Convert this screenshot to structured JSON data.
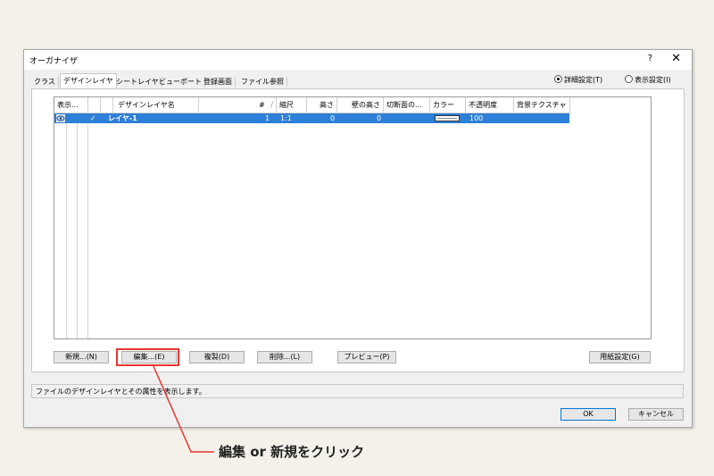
{
  "window": {
    "title": "オーガナイザ",
    "help": "?",
    "close": "✕"
  },
  "tabs": [
    "クラス",
    "デザインレイヤ",
    "シートレイヤ",
    "ビューポート",
    "登録画面",
    "ファイル参照"
  ],
  "active_tab": "デザインレイヤ",
  "view_mode": {
    "detail": "詳細設定(T)",
    "display": "表示設定(I)",
    "selected": "detail"
  },
  "table": {
    "headers": [
      "表示...",
      "",
      "",
      "デザインレイヤ名",
      "#",
      "縮尺",
      "高さ",
      "壁の高さ",
      "切断面の...",
      "カラー",
      "不透明度",
      "背景テクスチャ"
    ],
    "sort_marker": "/",
    "rows": [
      {
        "visible_icon": "eye-icon",
        "active": "✓",
        "name": "レイヤ-1",
        "number": "1",
        "scale": "1:1",
        "elevation": "0",
        "wall_height": "0",
        "color_swatch": "pattern",
        "opacity": "100",
        "texture": ""
      }
    ]
  },
  "buttons": {
    "new": "新規...(N)",
    "edit": "編集...(E)",
    "duplicate": "複製(D)",
    "delete": "削除...(L)",
    "preview": "プレビュー(P)",
    "page_setup": "用紙設定(G)",
    "ok": "OK",
    "cancel": "キャンセル"
  },
  "status": "ファイルのデザインレイヤとその属性を表示します。",
  "annotation": {
    "text": "編集 or 新規をクリック",
    "color": "#e8352b"
  },
  "colors": {
    "selection": "#2e7fd7",
    "ok_border": "#0078d7",
    "highlight": "#e8352b"
  }
}
